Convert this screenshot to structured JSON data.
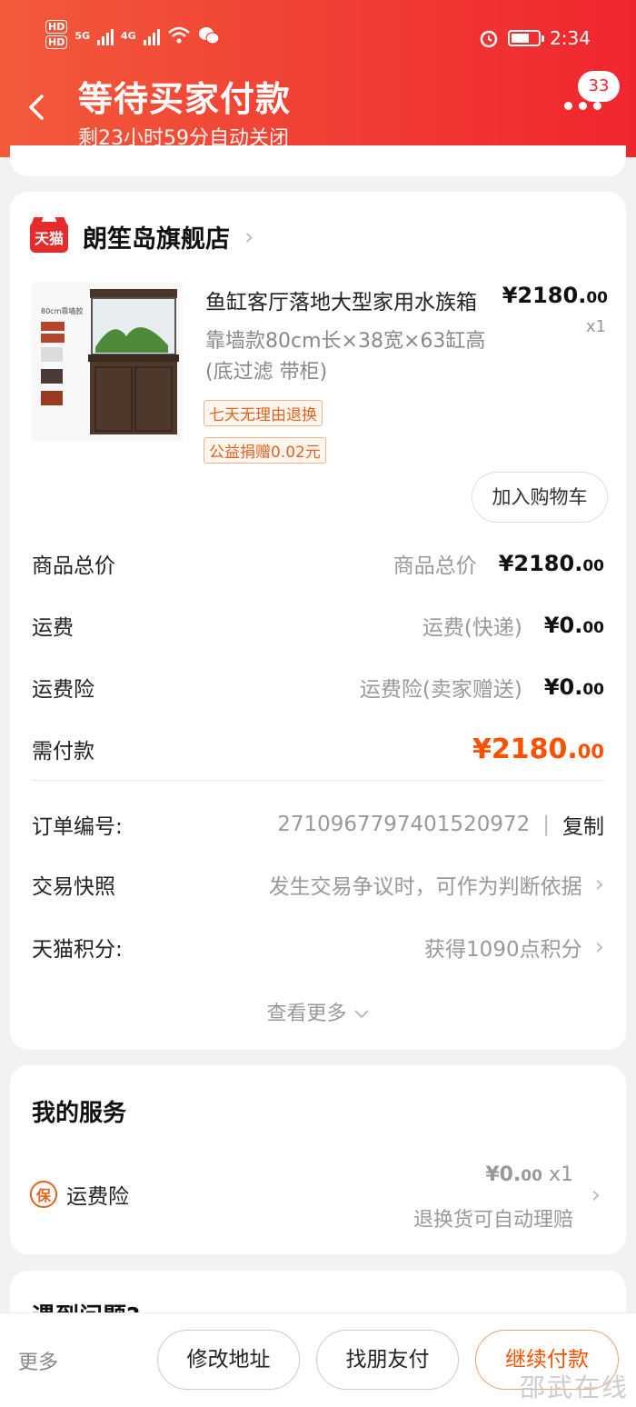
{
  "status_bar": {
    "time": "2:34",
    "hd1": "HD",
    "hd2": "HD",
    "net1": "5G",
    "net2": "4G"
  },
  "header": {
    "title": "等待买家付款",
    "subtitle": "剩23小时59分自动关闭",
    "badge_count": "33"
  },
  "shop": {
    "logo_text": "天猫",
    "name": "朗笙岛旗舰店"
  },
  "product": {
    "image_label": "80cm靠墙款",
    "title": "鱼缸客厅落地大型家用水族箱",
    "spec": "靠墙款80cm长×38宽×63缸高(底过滤 带柜)",
    "price_main": "¥2180.",
    "price_cents": "00",
    "qty": "x1",
    "tags": [
      "七天无理由退换",
      "公益捐赠0.02元"
    ],
    "cart_button": "加入购物车"
  },
  "costs": [
    {
      "label": "商品总价",
      "sub": "商品总价",
      "main": "¥2180.",
      "cents": "00"
    },
    {
      "label": "运费",
      "sub": "运费(快递)",
      "main": "¥0.",
      "cents": "00"
    },
    {
      "label": "运费险",
      "sub": "运费险(卖家赠送)",
      "main": "¥0.",
      "cents": "00"
    },
    {
      "label": "需付款",
      "sub": "",
      "main": "¥2180.",
      "cents": "00"
    }
  ],
  "info": {
    "order_label": "订单编号:",
    "order_no": "2710967797401520972",
    "copy": "复制",
    "snapshot_label": "交易快照",
    "snapshot_val": "发生交易争议时，可作为判断依据",
    "points_label": "天猫积分:",
    "points_val": "获得1090点积分",
    "see_more": "查看更多"
  },
  "service": {
    "title": "我的服务",
    "icon_text": "保",
    "name": "运费险",
    "price_main": "¥0.",
    "price_cents": "00",
    "qty": "x1",
    "note": "退换货可自动理赔"
  },
  "help": {
    "title": "遇到问题?"
  },
  "bottom": {
    "more": "更多",
    "btn1": "修改地址",
    "btn2": "找朋友付",
    "btn3": "继续付款"
  },
  "watermark": "邵武在线",
  "colors": {
    "header_start": "#f25a3a",
    "header_end": "#f0262f",
    "accent": "#ff5000"
  }
}
